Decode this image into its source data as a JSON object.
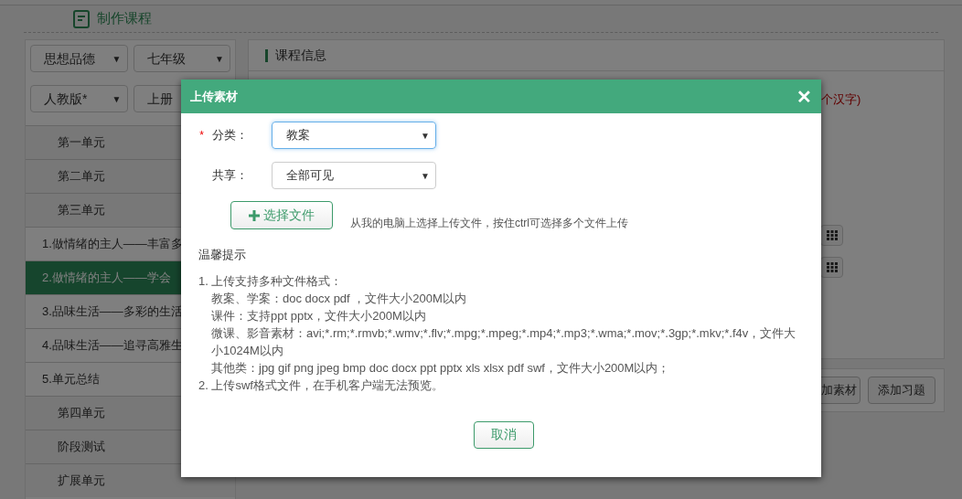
{
  "header": {
    "title": "制作课程"
  },
  "filters": [
    {
      "value": "思想品德",
      "caret": "▼"
    },
    {
      "value": "七年级",
      "caret": "▼"
    },
    {
      "value": "人教版*",
      "caret": "▼"
    },
    {
      "value": "上册"
    }
  ],
  "outline": [
    {
      "label": "第一单元",
      "selected": false
    },
    {
      "label": "第二单元",
      "selected": false
    },
    {
      "label": "第三单元",
      "selected": false,
      "children": [
        {
          "label": "1.做情绪的主人——丰富多",
          "selected": false
        },
        {
          "label": "2.做情绪的主人——学会",
          "selected": true
        },
        {
          "label": "3.品味生活——多彩的生活",
          "selected": false
        },
        {
          "label": "4.品味生活——追寻高雅生",
          "selected": false
        },
        {
          "label": "5.单元总结",
          "selected": false
        }
      ]
    },
    {
      "label": "第四单元",
      "selected": false
    },
    {
      "label": "阶段测试",
      "selected": false
    },
    {
      "label": "扩展单元",
      "selected": false
    }
  ],
  "course_panel": {
    "title": "课程信息",
    "hint": "个汉字)",
    "buttons": [
      "加素材",
      "添加习题"
    ]
  },
  "dialog": {
    "title": "上传素材",
    "close": "✕",
    "fields": [
      {
        "label": "分类：",
        "required_mark": "*",
        "value": "教案",
        "caret": "▼",
        "focused": true
      },
      {
        "label": "共享：",
        "value": "全部可见",
        "caret": "▼",
        "focused": false
      }
    ],
    "choose_button": "选择文件",
    "choose_hint": "从我的电脑上选择上传文件，按住ctrl可选择多个文件上传",
    "tips_title": "温馨提示",
    "tips": [
      {
        "kind": "item",
        "text": "1. 上传支持多种文件格式："
      },
      {
        "kind": "sub",
        "text": "教案、学案：doc docx pdf ，文件大小200M以内"
      },
      {
        "kind": "sub",
        "text": "课件：支持ppt pptx，文件大小200M以内"
      },
      {
        "kind": "sub",
        "text": "微课、影音素材：avi;*.rm;*.rmvb;*.wmv;*.flv;*.mpg;*.mpeg;*.mp4;*.mp3;*.wma;*.mov;*.3gp;*.mkv;*.f4v，文件大小1024M以内"
      },
      {
        "kind": "sub",
        "text": "其他类：jpg gif png jpeg bmp doc docx ppt pptx xls xlsx pdf swf，文件大小200M以内；"
      },
      {
        "kind": "item",
        "text": "2. 上传swf格式文件，在手机客户端无法预览。"
      }
    ],
    "cancel": "取消"
  }
}
